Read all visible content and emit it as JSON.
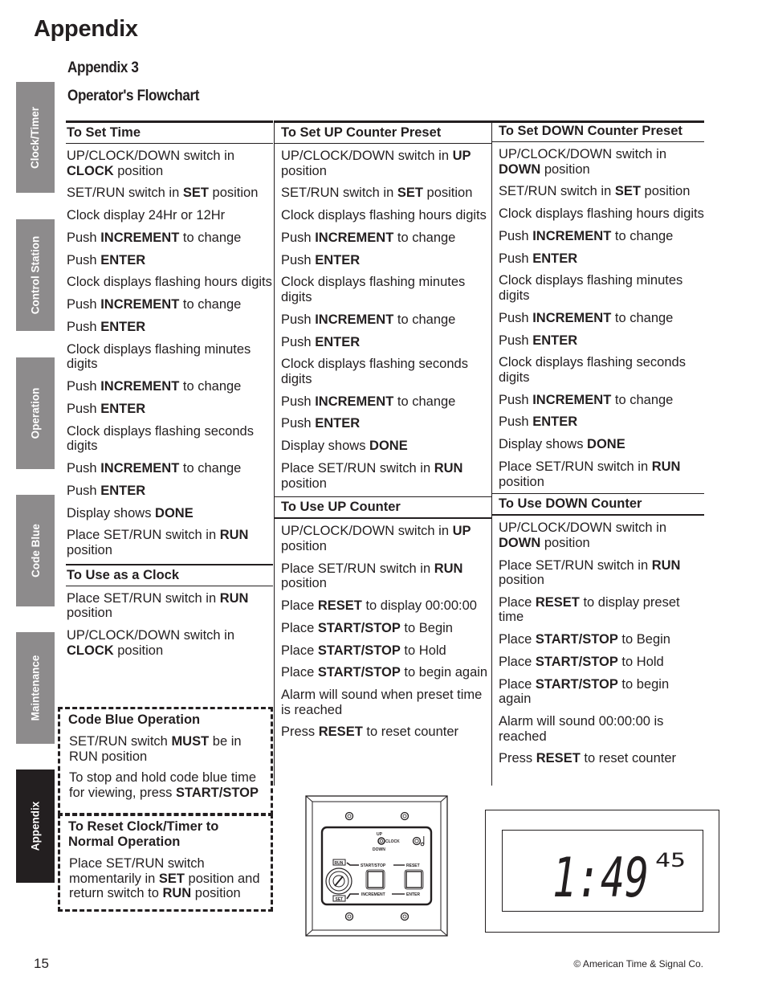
{
  "page": {
    "title": "Appendix",
    "subtitle": "Appendix 3",
    "section_title": "Operator's Flowchart",
    "page_number": "15",
    "copyright": "© American Time & Signal Co."
  },
  "side_tabs": [
    {
      "label": "Clock/Timer",
      "active": false
    },
    {
      "label": "Control Station",
      "active": false
    },
    {
      "label": "Operation",
      "active": false
    },
    {
      "label": "Code Blue",
      "active": false
    },
    {
      "label": "Maintenance",
      "active": false
    },
    {
      "label": "Appendix",
      "active": true
    }
  ],
  "sections": {
    "set_time": {
      "heading": "To Set Time",
      "steps": [
        [
          [
            "UP/CLOCK/DOWN switch in ",
            0
          ],
          [
            "CLOCK",
            1
          ],
          [
            " position",
            0
          ]
        ],
        [
          [
            "SET/RUN switch in ",
            0
          ],
          [
            "SET",
            1
          ],
          [
            " position",
            0
          ]
        ],
        [
          [
            "Clock display 24Hr or 12Hr",
            0
          ]
        ],
        [
          [
            "Push ",
            0
          ],
          [
            "INCREMENT",
            1
          ],
          [
            " to change",
            0
          ]
        ],
        [
          [
            "Push ",
            0
          ],
          [
            "ENTER",
            1
          ]
        ],
        [
          [
            "Clock displays flashing hours digits",
            0
          ]
        ],
        [
          [
            "Push ",
            0
          ],
          [
            "INCREMENT",
            1
          ],
          [
            " to change",
            0
          ]
        ],
        [
          [
            "Push ",
            0
          ],
          [
            "ENTER",
            1
          ]
        ],
        [
          [
            "Clock displays flashing minutes digits",
            0
          ]
        ],
        [
          [
            "Push ",
            0
          ],
          [
            "INCREMENT",
            1
          ],
          [
            " to change",
            0
          ]
        ],
        [
          [
            "Push ",
            0
          ],
          [
            "ENTER",
            1
          ]
        ],
        [
          [
            "Clock displays flashing seconds digits",
            0
          ]
        ],
        [
          [
            "Push ",
            0
          ],
          [
            "INCREMENT",
            1
          ],
          [
            " to change",
            0
          ]
        ],
        [
          [
            "Push ",
            0
          ],
          [
            "ENTER",
            1
          ]
        ],
        [
          [
            "Display shows ",
            0
          ],
          [
            "DONE",
            1
          ]
        ],
        [
          [
            "Place SET/RUN switch in ",
            0
          ],
          [
            "RUN",
            1
          ],
          [
            " position",
            0
          ]
        ]
      ]
    },
    "use_clock": {
      "heading": "To Use as a Clock",
      "steps": [
        [
          [
            "Place SET/RUN switch in ",
            0
          ],
          [
            "RUN",
            1
          ],
          [
            " position",
            0
          ]
        ],
        [
          [
            "UP/CLOCK/DOWN switch in ",
            0
          ],
          [
            "CLOCK",
            1
          ],
          [
            " position",
            0
          ]
        ]
      ]
    },
    "set_up_preset": {
      "heading": "To Set UP Counter Preset",
      "steps": [
        [
          [
            "UP/CLOCK/DOWN switch in ",
            0
          ],
          [
            "UP",
            1
          ],
          [
            " position",
            0
          ]
        ],
        [
          [
            "SET/RUN switch in ",
            0
          ],
          [
            "SET",
            1
          ],
          [
            " position",
            0
          ]
        ],
        [
          [
            "Clock displays flashing hours digits",
            0
          ]
        ],
        [
          [
            "Push ",
            0
          ],
          [
            "INCREMENT",
            1
          ],
          [
            " to change",
            0
          ]
        ],
        [
          [
            "Push ",
            0
          ],
          [
            "ENTER",
            1
          ]
        ],
        [
          [
            "Clock displays flashing minutes digits",
            0
          ]
        ],
        [
          [
            "Push ",
            0
          ],
          [
            "INCREMENT",
            1
          ],
          [
            " to change",
            0
          ]
        ],
        [
          [
            "Push ",
            0
          ],
          [
            "ENTER",
            1
          ]
        ],
        [
          [
            "Clock displays flashing seconds digits",
            0
          ]
        ],
        [
          [
            "Push ",
            0
          ],
          [
            "INCREMENT",
            1
          ],
          [
            " to change",
            0
          ]
        ],
        [
          [
            "Push ",
            0
          ],
          [
            "ENTER",
            1
          ]
        ],
        [
          [
            "Display shows ",
            0
          ],
          [
            "DONE",
            1
          ]
        ],
        [
          [
            "Place SET/RUN switch in ",
            0
          ],
          [
            "RUN",
            1
          ],
          [
            " position",
            0
          ]
        ]
      ]
    },
    "use_up_counter": {
      "heading": "To Use UP Counter",
      "steps": [
        [
          [
            "UP/CLOCK/DOWN switch in ",
            0
          ],
          [
            "UP",
            1
          ],
          [
            " position",
            0
          ]
        ],
        [
          [
            "Place SET/RUN switch in ",
            0
          ],
          [
            "RUN",
            1
          ],
          [
            " position",
            0
          ]
        ],
        [
          [
            "Place ",
            0
          ],
          [
            "RESET",
            1
          ],
          [
            " to display 00:00:00",
            0
          ]
        ],
        [
          [
            "Place ",
            0
          ],
          [
            "START/STOP",
            1
          ],
          [
            " to Begin",
            0
          ]
        ],
        [
          [
            "Place ",
            0
          ],
          [
            "START/STOP",
            1
          ],
          [
            " to Hold",
            0
          ]
        ],
        [
          [
            "Place ",
            0
          ],
          [
            "START/STOP",
            1
          ],
          [
            " to begin again",
            0
          ]
        ],
        [
          [
            "Alarm will sound when preset time is reached",
            0
          ]
        ],
        [
          [
            "Press ",
            0
          ],
          [
            "RESET",
            1
          ],
          [
            " to reset counter",
            0
          ]
        ]
      ]
    },
    "set_down_preset": {
      "heading": "To Set DOWN Counter Preset",
      "steps": [
        [
          [
            "UP/CLOCK/DOWN switch in ",
            0
          ],
          [
            "DOWN",
            1
          ],
          [
            " position",
            0
          ]
        ],
        [
          [
            "SET/RUN switch in ",
            0
          ],
          [
            "SET",
            1
          ],
          [
            " position",
            0
          ]
        ],
        [
          [
            "Clock displays flashing hours digits",
            0
          ]
        ],
        [
          [
            "Push ",
            0
          ],
          [
            "INCREMENT",
            1
          ],
          [
            " to change",
            0
          ]
        ],
        [
          [
            "Push ",
            0
          ],
          [
            "ENTER",
            1
          ]
        ],
        [
          [
            "Clock displays flashing minutes digits",
            0
          ]
        ],
        [
          [
            "Push ",
            0
          ],
          [
            "INCREMENT",
            1
          ],
          [
            " to change",
            0
          ]
        ],
        [
          [
            "Push ",
            0
          ],
          [
            "ENTER",
            1
          ]
        ],
        [
          [
            "Clock displays flashing seconds digits",
            0
          ]
        ],
        [
          [
            "Push ",
            0
          ],
          [
            "INCREMENT",
            1
          ],
          [
            " to change",
            0
          ]
        ],
        [
          [
            "Push ",
            0
          ],
          [
            "ENTER",
            1
          ]
        ],
        [
          [
            "Display shows ",
            0
          ],
          [
            "DONE",
            1
          ]
        ],
        [
          [
            "Place SET/RUN switch in ",
            0
          ],
          [
            "RUN",
            1
          ],
          [
            " position",
            0
          ]
        ]
      ]
    },
    "use_down_counter": {
      "heading": "To Use DOWN Counter",
      "steps": [
        [
          [
            "UP/CLOCK/DOWN switch in ",
            0
          ],
          [
            "DOWN",
            1
          ],
          [
            " position",
            0
          ]
        ],
        [
          [
            "Place SET/RUN switch in ",
            0
          ],
          [
            "RUN",
            1
          ],
          [
            " position",
            0
          ]
        ],
        [
          [
            "Place ",
            0
          ],
          [
            "RESET",
            1
          ],
          [
            " to display preset time",
            0
          ]
        ],
        [
          [
            "Place ",
            0
          ],
          [
            "START/STOP",
            1
          ],
          [
            " to Begin",
            0
          ]
        ],
        [
          [
            "Place ",
            0
          ],
          [
            "START/STOP",
            1
          ],
          [
            " to Hold",
            0
          ]
        ],
        [
          [
            "Place ",
            0
          ],
          [
            "START/STOP",
            1
          ],
          [
            " to begin again",
            0
          ]
        ],
        [
          [
            "Alarm will sound  00:00:00 is reached",
            0
          ]
        ],
        [
          [
            "Press ",
            0
          ],
          [
            "RESET",
            1
          ],
          [
            " to reset counter",
            0
          ]
        ]
      ]
    },
    "code_blue": {
      "heading": "Code Blue Operation",
      "steps": [
        [
          [
            "SET/RUN switch ",
            0
          ],
          [
            "MUST",
            1
          ],
          [
            " be in RUN position",
            0
          ]
        ],
        [
          [
            "To stop and hold code blue time for viewing, press ",
            0
          ],
          [
            "START/STOP",
            1
          ]
        ]
      ]
    },
    "reset_normal": {
      "heading": "To Reset Clock/Timer to Normal Operation",
      "steps": [
        [
          [
            "Place SET/RUN switch momentarily in ",
            0
          ],
          [
            "SET",
            1
          ],
          [
            " position and return switch to ",
            0
          ],
          [
            "RUN",
            1
          ],
          [
            " position",
            0
          ]
        ]
      ]
    }
  },
  "control_station": {
    "switch_up": "UP",
    "switch_clock": "CLOCK",
    "switch_down": "DOWN",
    "key_run": "RUN",
    "key_set": "SET",
    "start_stop": "START/STOP",
    "reset": "RESET",
    "increment": "INCREMENT",
    "enter": "ENTER",
    "alarm_icon": "music-note-icon"
  },
  "display": {
    "main": "1:49",
    "seconds": "45"
  }
}
